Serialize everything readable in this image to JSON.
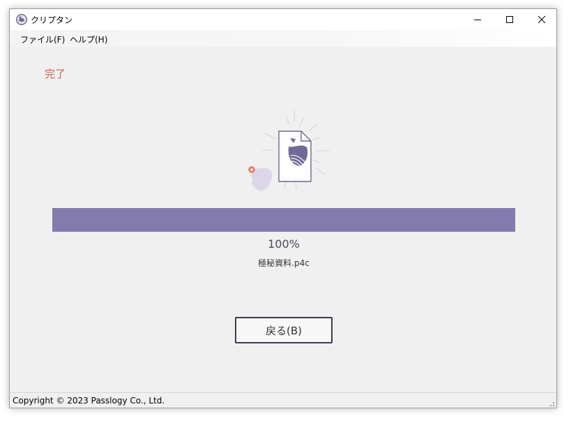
{
  "window": {
    "title": "クリプタン",
    "title_icon": "app-logo-icon",
    "controls": [
      "minimize-icon",
      "maximize-icon",
      "close-icon"
    ]
  },
  "menu": {
    "file_label": "ファイル(F)",
    "help_label": "ヘルプ(H)"
  },
  "main": {
    "status": "完了",
    "illustration_icon": "encrypted-document-icon",
    "progress_percent": 100,
    "progress_text": "100%",
    "file_name": "極秘資料.p4c",
    "back_button_label": "戻る(B)"
  },
  "footer": {
    "copyright": "Copyright © 2023 Passlogy Co., Ltd."
  },
  "colors": {
    "accent": "#837bae",
    "status_text": "#c8624f",
    "button_border": "#3e3a4f"
  }
}
